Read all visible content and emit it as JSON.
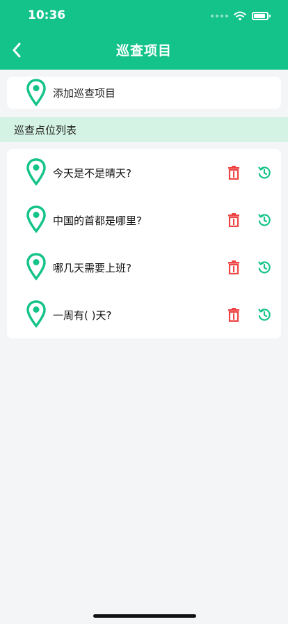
{
  "status_bar": {
    "time": "10:36"
  },
  "nav": {
    "title": "巡查项目"
  },
  "add_item": {
    "label": "添加巡查项目"
  },
  "section": {
    "title": "巡查点位列表"
  },
  "items": [
    {
      "text": "今天是不是晴天?"
    },
    {
      "text": "中国的首都是哪里?"
    },
    {
      "text": "哪几天需要上班?"
    },
    {
      "text": "一周有( )天?"
    }
  ],
  "colors": {
    "brand": "#14c389",
    "section_bg": "#d4f3e5",
    "delete": "#ef4444",
    "background": "#f4f5f7"
  },
  "icons": {
    "back": "chevron-left-icon",
    "pin": "location-pin-icon",
    "delete": "trash-icon",
    "reset": "history-icon"
  }
}
